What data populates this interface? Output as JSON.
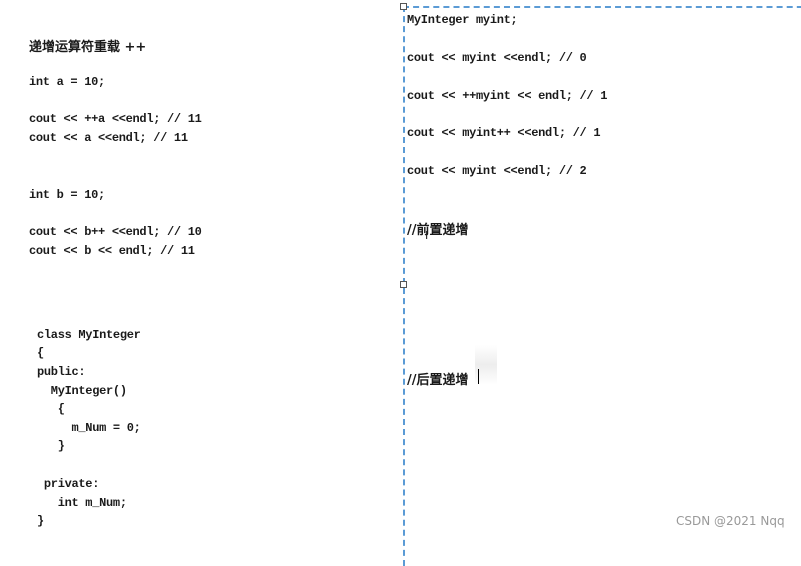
{
  "left_panel": {
    "title": "递增运算符重载 ++",
    "snippet_a": [
      "int a = 10;",
      "cout << ++a <<endl; // 11",
      "cout << a <<endl; // 11"
    ],
    "snippet_b": [
      "int b = 10;",
      "cout << b++ <<endl; // 10",
      "cout << b << endl; // 11"
    ],
    "class_code": [
      "class MyInteger",
      "{",
      "public:",
      "  MyInteger()",
      "   {",
      "     m_Num = 0;",
      "   }",
      "",
      " private:",
      "   int m_Num;",
      "}"
    ]
  },
  "right_panel": {
    "lines": [
      "MyInteger myint;",
      "cout << myint <<endl; // 0",
      "cout << ++myint << endl; // 1",
      "cout << myint++ <<endl; // 1",
      "cout << myint <<endl; // 2"
    ],
    "comment_prefix": "//前置递增",
    "comment_postfix": "//后置递增"
  },
  "selection_color": "#5b9bd5",
  "watermark": "CSDN @2021 Nqq"
}
